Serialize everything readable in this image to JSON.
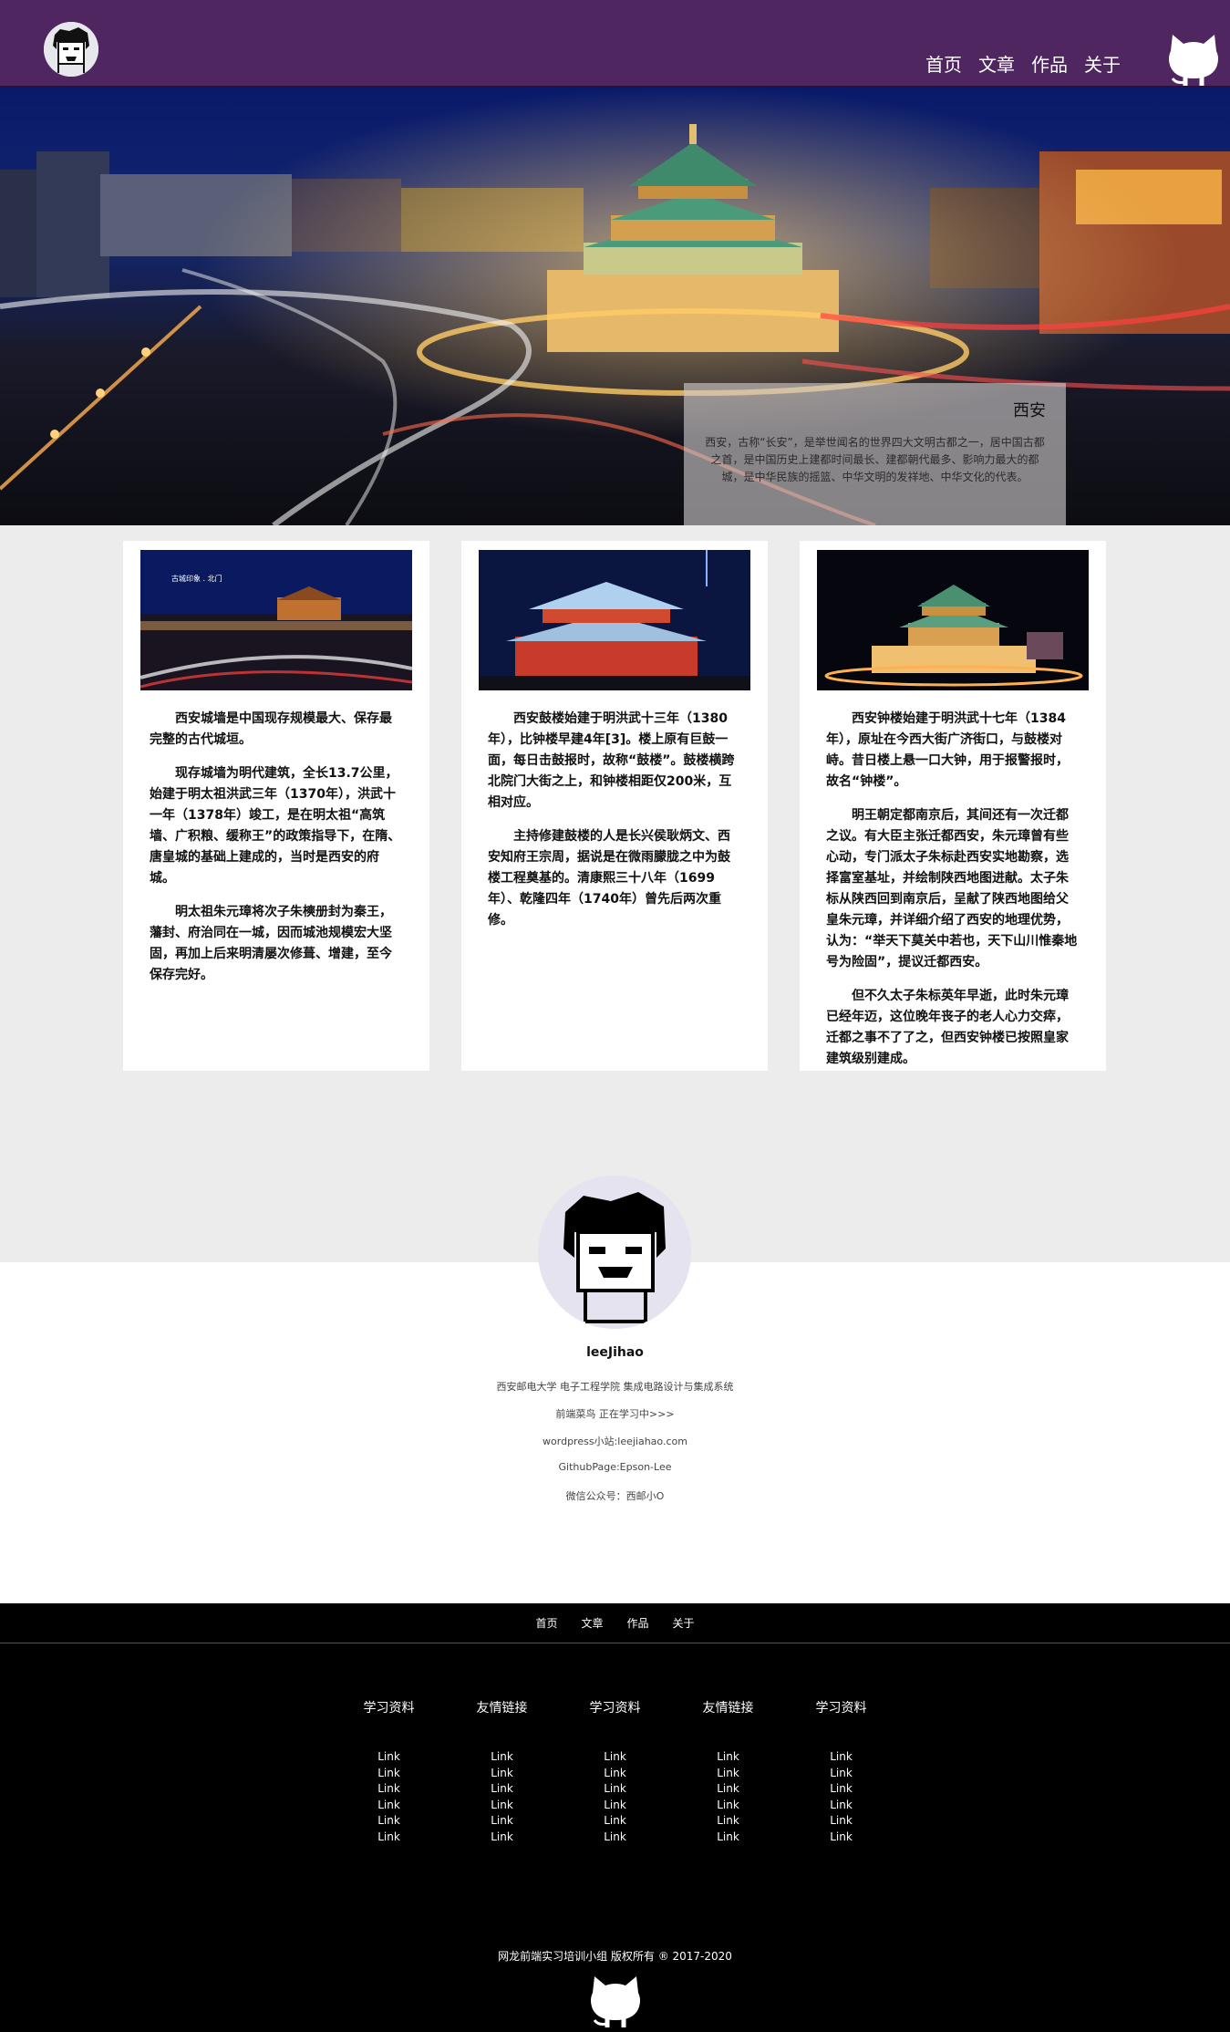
{
  "header": {
    "nav": [
      "首页",
      "文章",
      "作品",
      "关于"
    ]
  },
  "hero": {
    "title": "西安",
    "text": "西安，古称“长安”，是举世闻名的世界四大文明古都之一，居中国古都之首，是中国历史上建都时间最长、建都朝代最多、影响力最大的都城，是中华民族的摇篮、中华文明的发祥地、中华文化的代表。"
  },
  "cards": [
    {
      "photo_caption": "古城印象 . 北门",
      "paragraphs": [
        "西安城墙是中国现存规模最大、保存最完整的古代城垣。",
        "现存城墙为明代建筑，全长13.7公里，始建于明太祖洪武三年（1370年），洪武十一年（1378年）竣工，是在明太祖“高筑墙、广积粮、缓称王”的政策指导下，在隋、唐皇城的基础上建成的，当时是西安的府城。",
        "明太祖朱元璋将次子朱樉册封为秦王，藩封、府治同在一城，因而城池规模宏大坚固，再加上后来明清屡次修葺、增建，至今保存完好。"
      ]
    },
    {
      "photo_caption": "",
      "paragraphs": [
        "西安鼓楼始建于明洪武十三年（1380年），比钟楼早建4年[3]。楼上原有巨鼓一面，每日击鼓报时，故称“鼓楼”。鼓楼横跨北院门大街之上，和钟楼相距仅200米，互相对应。",
        "主持修建鼓楼的人是长兴侯耿炳文、西安知府王宗周，据说是在微雨朦胧之中为鼓楼工程奠基的。清康熙三十八年（1699年）、乾隆四年（1740年）曾先后两次重修。"
      ]
    },
    {
      "photo_caption": "",
      "paragraphs": [
        "西安钟楼始建于明洪武十七年（1384年），原址在今西大街广济街口，与鼓楼对峙。昔日楼上悬一口大钟，用于报警报时，故名“钟楼”。",
        "明王朝定都南京后，其间还有一次迁都之议。有大臣主张迁都西安，朱元璋曾有些心动，专门派太子朱标赴西安实地勘察，选择富室基址，并绘制陕西地图进献。太子朱标从陕西回到南京后，呈献了陕西地图给父皇朱元璋，并详细介绍了西安的地理优势，认为：“举天下莫关中若也，天下山川惟秦地号为险固”，提议迁都西安。",
        "但不久太子朱标英年早逝，此时朱元璋已经年迈，这位晚年丧子的老人心力交瘁，迁都之事不了了之，但西安钟楼已按照皇家建筑级别建成。"
      ]
    }
  ],
  "profile": {
    "name": "leeJihao",
    "lines": [
      "西安邮电大学 电子工程学院 集成电路设计与集成系统",
      "前端菜鸟 正在学习中>>>",
      "wordpress小站:leejiahao.com",
      "GithubPage:Epson-Lee",
      "微信公众号：西邮小O"
    ]
  },
  "footer": {
    "nav": [
      "首页",
      "文章",
      "作品",
      "关于"
    ],
    "columns": [
      {
        "title": "学习资料",
        "links": [
          "Link",
          "Link",
          "Link",
          "Link",
          "Link",
          "Link"
        ]
      },
      {
        "title": "友情链接",
        "links": [
          "Link",
          "Link",
          "Link",
          "Link",
          "Link",
          "Link"
        ]
      },
      {
        "title": "学习资料",
        "links": [
          "Link",
          "Link",
          "Link",
          "Link",
          "Link",
          "Link"
        ]
      },
      {
        "title": "友情链接",
        "links": [
          "Link",
          "Link",
          "Link",
          "Link",
          "Link",
          "Link"
        ]
      },
      {
        "title": "学习资料",
        "links": [
          "Link",
          "Link",
          "Link",
          "Link",
          "Link",
          "Link"
        ]
      }
    ],
    "copyright": "网龙前端实习培训小组 版权所有 ® 2017-2020"
  },
  "colors": {
    "header_bg": "#4f2660",
    "section_bg": "#ececec",
    "footer_bg": "#000000"
  },
  "icons": [
    "avatar-logo-icon",
    "github-octocat-icon"
  ]
}
